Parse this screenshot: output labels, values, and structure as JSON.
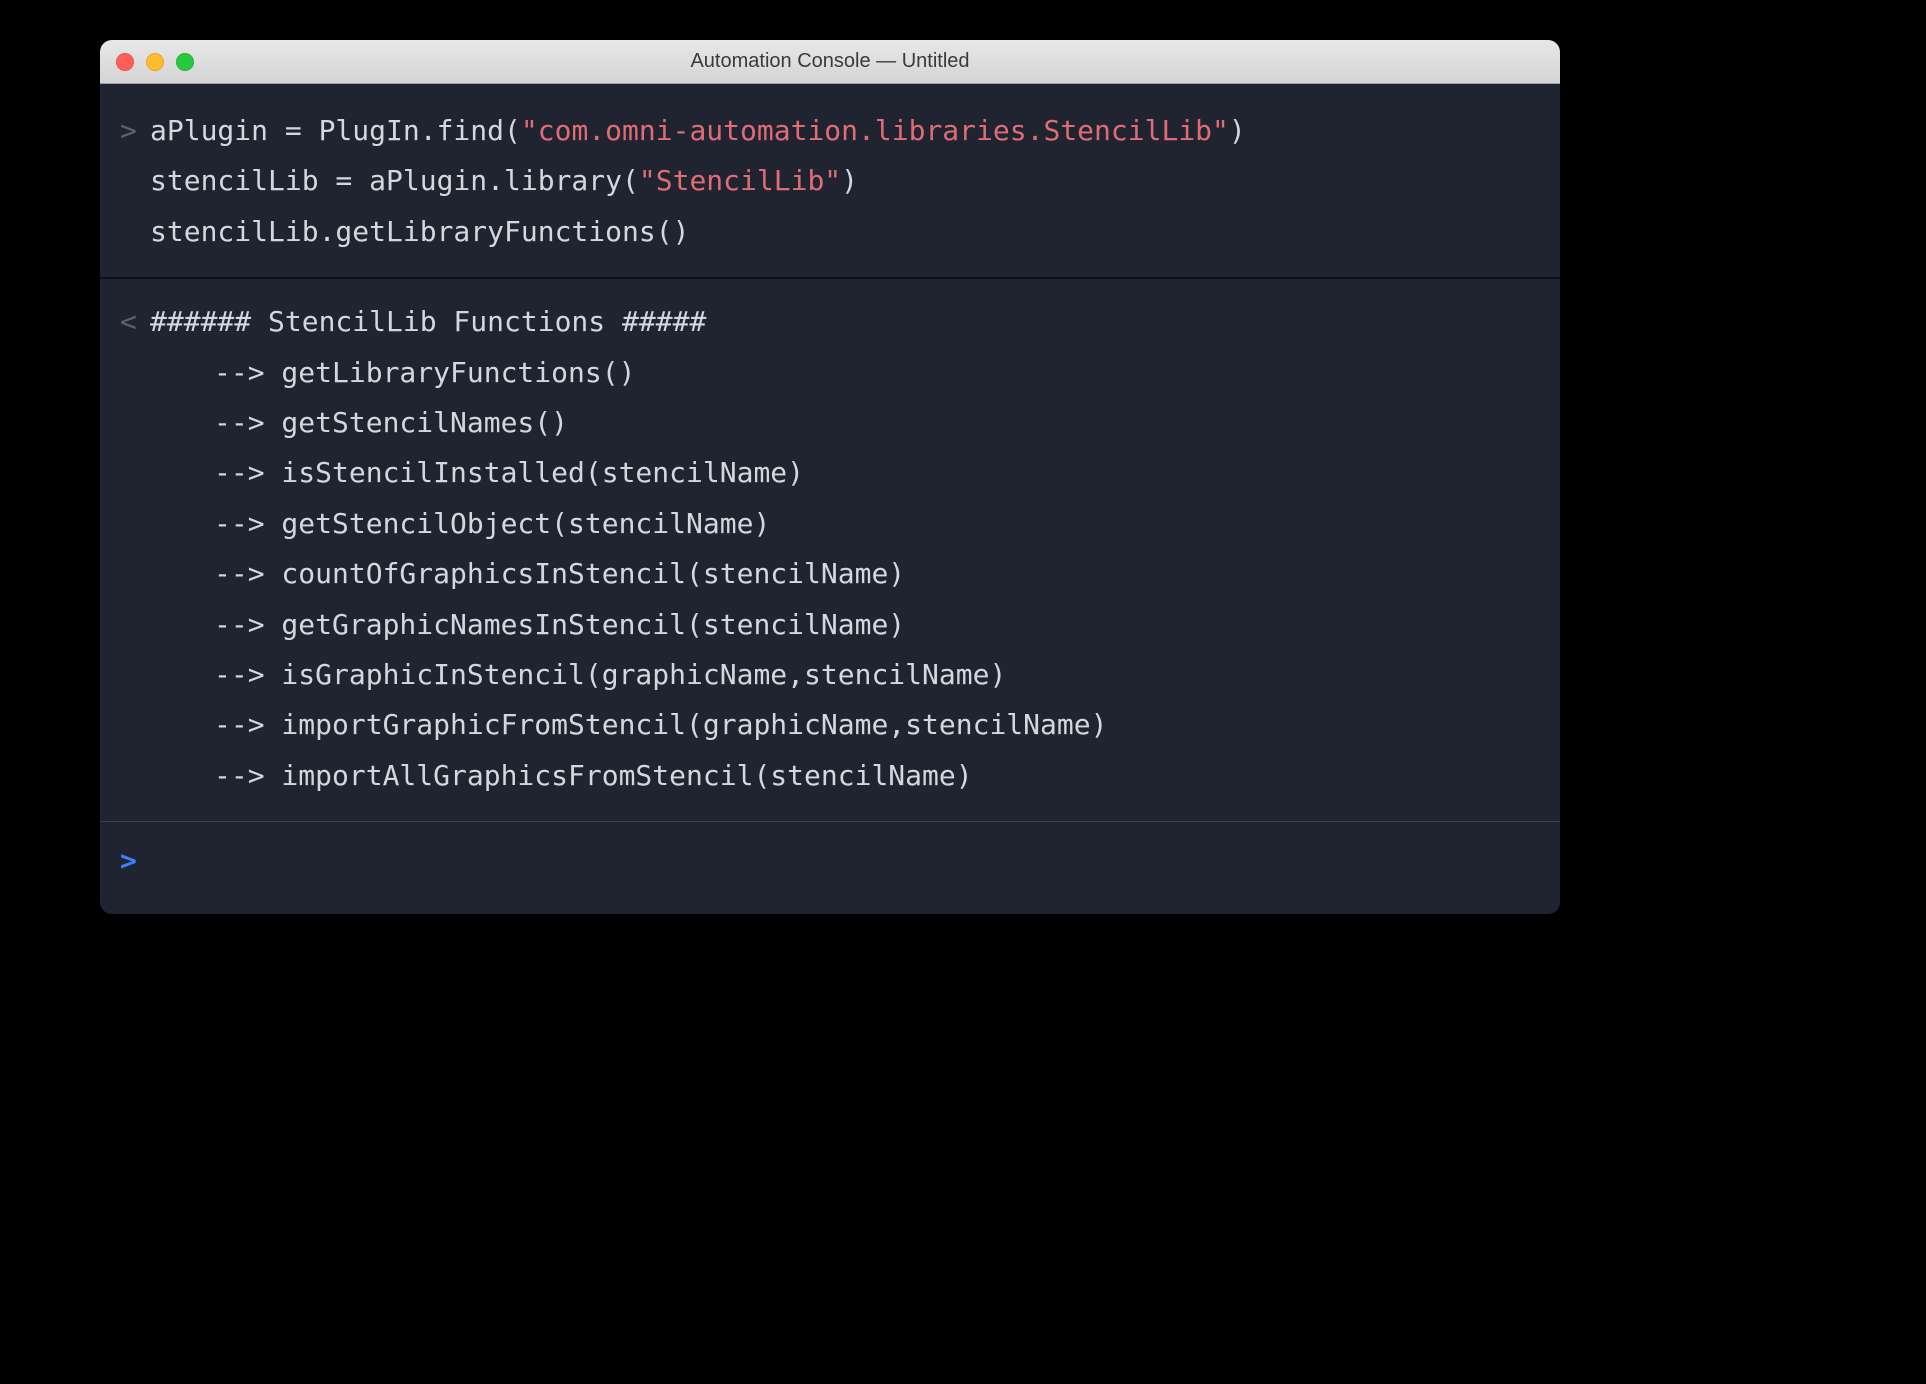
{
  "window": {
    "title": "Automation Console — Untitled"
  },
  "input": {
    "prompt": ">",
    "line1_pre": "aPlugin = PlugIn.find(",
    "line1_str": "\"com.omni-automation.libraries.StencilLib\"",
    "line1_post": ")",
    "line2_pre": "stencilLib = aPlugin.library(",
    "line2_str": "\"StencilLib\"",
    "line2_post": ")",
    "line3": "stencilLib.getLibraryFunctions()"
  },
  "output": {
    "prompt": "<",
    "header": "###### StencilLib Functions #####",
    "items": [
      "--> getLibraryFunctions()",
      "--> getStencilNames()",
      "--> isStencilInstalled(stencilName)",
      "--> getStencilObject(stencilName)",
      "--> countOfGraphicsInStencil(stencilName)",
      "--> getGraphicNamesInStencil(stencilName)",
      "--> isGraphicInStencil(graphicName,stencilName)",
      "--> importGraphicFromStencil(graphicName,stencilName)",
      "--> importAllGraphicsFromStencil(stencilName)"
    ]
  },
  "prompt": {
    "symbol": ">"
  }
}
